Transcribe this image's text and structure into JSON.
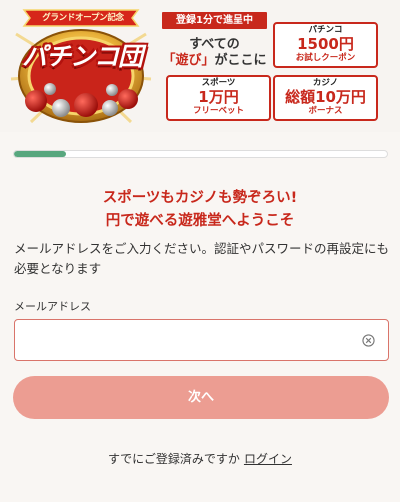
{
  "banner": {
    "logo": {
      "ribbon_text": "グランドオープン記念",
      "title": "パチンコ団"
    },
    "registration_badge": "登録1分で進呈中",
    "tagline_line1": "すべての",
    "tagline_line2_highlight": "「遊び」",
    "tagline_line2_rest": "がここに",
    "offers": [
      {
        "label": "パチンコ",
        "amount": "1500円",
        "sub": "お試しクーポン"
      },
      {
        "label": "スポーツ",
        "amount": "1万円",
        "sub": "フリーベット"
      },
      {
        "label": "カジノ",
        "amount": "総額10万円",
        "sub": "ボーナス"
      }
    ]
  },
  "progress": {
    "value_percent": 14,
    "color": "#58a77e"
  },
  "main": {
    "headline_line1": "スポーツもカジノも勢ぞろい!",
    "headline_line2": "円で遊べる遊雅堂へようこそ",
    "description": "メールアドレスをご入力ください。認証やパスワードの再設定にも必要となります",
    "email_label": "メールアドレス",
    "email_value": "",
    "email_placeholder": "",
    "next_button": "次へ",
    "login_prompt": "すでにご登録済みですか",
    "login_link": "ログイン"
  },
  "colors": {
    "accent_red": "#c8281c",
    "button_pink": "#ec9d92",
    "input_border": "#d9746a"
  },
  "icons": {
    "clear": "circle-x-icon",
    "logo": "pachinko-logo-icon"
  }
}
